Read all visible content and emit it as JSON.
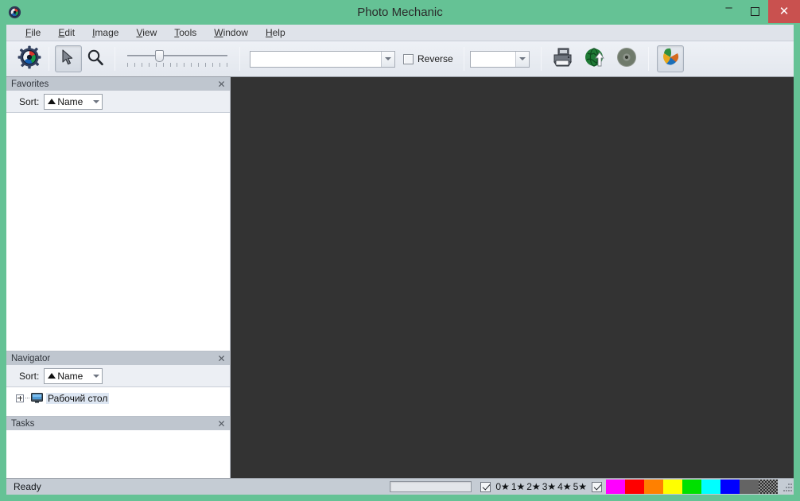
{
  "window": {
    "title": "Photo Mechanic",
    "app_icon": "photo-mechanic-icon",
    "minimize_label": "–",
    "maximize_label": "❐",
    "close_label": "✕",
    "frame_color": "#65c295",
    "titlebar_text_color": "#2a2a2a"
  },
  "menu": {
    "items": [
      {
        "label": "File",
        "accel": "F"
      },
      {
        "label": "Edit",
        "accel": "E"
      },
      {
        "label": "Image",
        "accel": "I"
      },
      {
        "label": "View",
        "accel": "V"
      },
      {
        "label": "Tools",
        "accel": "T"
      },
      {
        "label": "Window",
        "accel": "W"
      },
      {
        "label": "Help",
        "accel": "H"
      }
    ]
  },
  "toolbar": {
    "gear_icon": "color-wheel-gear-icon",
    "pointer_icon": "cursor-arrow-icon",
    "pointer_pressed": true,
    "zoom_icon": "magnifier-icon",
    "slider": {
      "name": "thumbnail-size-slider",
      "value_percent": 30,
      "tick_count": 15
    },
    "filter_combo": {
      "value": "",
      "placeholder": ""
    },
    "reverse_checkbox": {
      "label": "Reverse",
      "checked": false
    },
    "preset_combo": {
      "value": "",
      "placeholder": ""
    },
    "print_icon": "printer-icon",
    "upload_icon": "globe-upload-icon",
    "burn_icon": "cd-burn-icon",
    "contactsheet_icon": "photo-mechanic-pinwheel-icon",
    "contactsheet_pressed": true
  },
  "sidebar": {
    "panels": [
      {
        "title": "Favorites",
        "close_label": "✕",
        "sort_label": "Sort:",
        "sort_value": "Name",
        "sort_direction": "ascending",
        "items": []
      },
      {
        "title": "Navigator",
        "close_label": "✕",
        "sort_label": "Sort:",
        "sort_value": "Name",
        "sort_direction": "ascending",
        "tree": [
          {
            "label": "Рабочий стол",
            "icon": "monitor-icon",
            "expanded": false,
            "selected": true
          }
        ]
      },
      {
        "title": "Tasks",
        "close_label": "✕",
        "items": []
      }
    ]
  },
  "main": {
    "background_color": "#333333",
    "content": ""
  },
  "status_bar": {
    "text": "Ready",
    "progress_value": "",
    "rating_filter_checkbox": {
      "checked": true
    },
    "color_filter_checkbox": {
      "checked": true
    },
    "ratings": [
      "0★",
      "1★",
      "2★",
      "3★",
      "4★",
      "5★"
    ],
    "color_classes": [
      {
        "name": "magenta",
        "hex": "#ff00ff"
      },
      {
        "name": "red",
        "hex": "#ff0000"
      },
      {
        "name": "orange",
        "hex": "#ff8000"
      },
      {
        "name": "yellow",
        "hex": "#ffff00"
      },
      {
        "name": "green",
        "hex": "#00e000"
      },
      {
        "name": "cyan",
        "hex": "#00ffff"
      },
      {
        "name": "blue",
        "hex": "#0000ff"
      },
      {
        "name": "gray",
        "hex": "#646464"
      },
      {
        "name": "none",
        "hex": "#3a3a3a"
      }
    ],
    "resize_grip": "resize-grip-icon"
  }
}
